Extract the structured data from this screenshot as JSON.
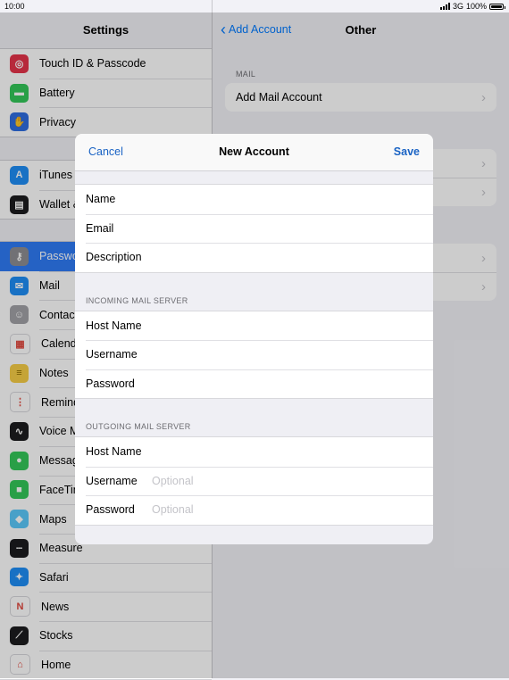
{
  "status": {
    "time": "10:00",
    "network": "3G",
    "battery": "100%"
  },
  "master": {
    "title": "Settings",
    "group1": [
      {
        "label": "Touch ID & Passcode",
        "icon": "fingerprint-icon",
        "color": "#e5344a"
      },
      {
        "label": "Battery",
        "icon": "battery-icon",
        "color": "#34c759"
      },
      {
        "label": "Privacy",
        "icon": "hand-icon",
        "color": "#2f6de0"
      }
    ],
    "group2": [
      {
        "label": "iTunes",
        "icon": "app-store-icon",
        "color": "#1e8ef5"
      },
      {
        "label": "Wallet &",
        "icon": "wallet-icon",
        "color": "#1c1c1e"
      }
    ],
    "group3": [
      {
        "label": "Passwo",
        "icon": "key-icon",
        "color": "#8e8e93",
        "selected": true
      },
      {
        "label": "Mail",
        "icon": "mail-icon",
        "color": "#1e8ef5"
      },
      {
        "label": "Contac",
        "icon": "contacts-icon",
        "color": "#a2a2a7"
      },
      {
        "label": "Calenda",
        "icon": "calendar-icon",
        "color": "#ffffff"
      },
      {
        "label": "Notes",
        "icon": "notes-icon",
        "color": "#f7cd46"
      },
      {
        "label": "Remind",
        "icon": "reminders-icon",
        "color": "#ffffff"
      },
      {
        "label": "Voice M",
        "icon": "voice-memos-icon",
        "color": "#1c1c1e"
      },
      {
        "label": "Messag",
        "icon": "messages-icon",
        "color": "#34c759"
      },
      {
        "label": "FaceTim",
        "icon": "facetime-icon",
        "color": "#34c759"
      },
      {
        "label": "Maps",
        "icon": "maps-icon",
        "color": "#5ac8fa"
      },
      {
        "label": "Measure",
        "icon": "measure-icon",
        "color": "#1c1c1e"
      },
      {
        "label": "Safari",
        "icon": "safari-icon",
        "color": "#1e8ef5"
      },
      {
        "label": "News",
        "icon": "news-icon",
        "color": "#ffffff"
      },
      {
        "label": "Stocks",
        "icon": "stocks-icon",
        "color": "#1c1c1e"
      },
      {
        "label": "Home",
        "icon": "home-icon",
        "color": "#ffffff"
      }
    ]
  },
  "detail": {
    "back_label": "Add Account",
    "title": "Other",
    "mail_section": "MAIL",
    "add_mail_label": "Add Mail Account"
  },
  "modal": {
    "cancel": "Cancel",
    "title": "New Account",
    "save": "Save",
    "group1": [
      {
        "label": "Name",
        "value": ""
      },
      {
        "label": "Email",
        "value": ""
      },
      {
        "label": "Description",
        "value": ""
      }
    ],
    "incoming_header": "INCOMING MAIL SERVER",
    "incoming": [
      {
        "label": "Host Name",
        "value": ""
      },
      {
        "label": "Username",
        "value": ""
      },
      {
        "label": "Password",
        "value": ""
      }
    ],
    "outgoing_header": "OUTGOING MAIL SERVER",
    "outgoing": [
      {
        "label": "Host Name",
        "value": ""
      },
      {
        "label": "Username",
        "placeholder": "Optional"
      },
      {
        "label": "Password",
        "placeholder": "Optional"
      }
    ]
  },
  "colors": {
    "accent": "#007aff",
    "selection": "#2f7bf6"
  }
}
